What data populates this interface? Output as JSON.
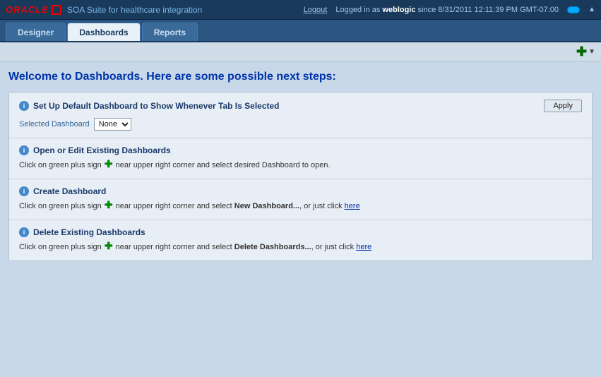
{
  "header": {
    "oracle_text": "ORACLE",
    "app_title": "SOA Suite for healthcare integration",
    "logout_label": "Logout",
    "logged_in_prefix": "Logged in as ",
    "username": "weblogic",
    "logged_in_suffix": " since 8/31/2011 12:11:39 PM GMT-07:00"
  },
  "tabs": [
    {
      "id": "designer",
      "label": "Designer",
      "active": false
    },
    {
      "id": "dashboards",
      "label": "Dashboards",
      "active": true
    },
    {
      "id": "reports",
      "label": "Reports",
      "active": false
    }
  ],
  "welcome_title": "Welcome to Dashboards.  Here are some possible next steps:",
  "step1": {
    "info_symbol": "i",
    "title": "Set Up Default Dashboard to Show Whenever Tab Is Selected",
    "apply_label": "Apply",
    "selected_dashboard_label": "Selected Dashboard",
    "dropdown_default": "None"
  },
  "step2": {
    "info_symbol": "i",
    "title": "Open or Edit Existing Dashboards",
    "desc_prefix": "Click on green plus sign ",
    "desc_suffix": " near upper right corner and select desired Dashboard to open."
  },
  "step3": {
    "info_symbol": "i",
    "title": "Create Dashboard",
    "desc_prefix": "Click on green plus sign ",
    "desc_middle": " near upper right corner and select ",
    "bold_part": "New Dashboard...",
    "desc_middle2": ", or just click ",
    "here_label": "here"
  },
  "step4": {
    "info_symbol": "i",
    "title": "Delete Existing Dashboards",
    "desc_prefix": "Click on green plus sign ",
    "desc_middle": " near upper right corner and select ",
    "bold_part": "Delete Dashboards...",
    "desc_middle2": ", or just click ",
    "here_label": "here"
  }
}
